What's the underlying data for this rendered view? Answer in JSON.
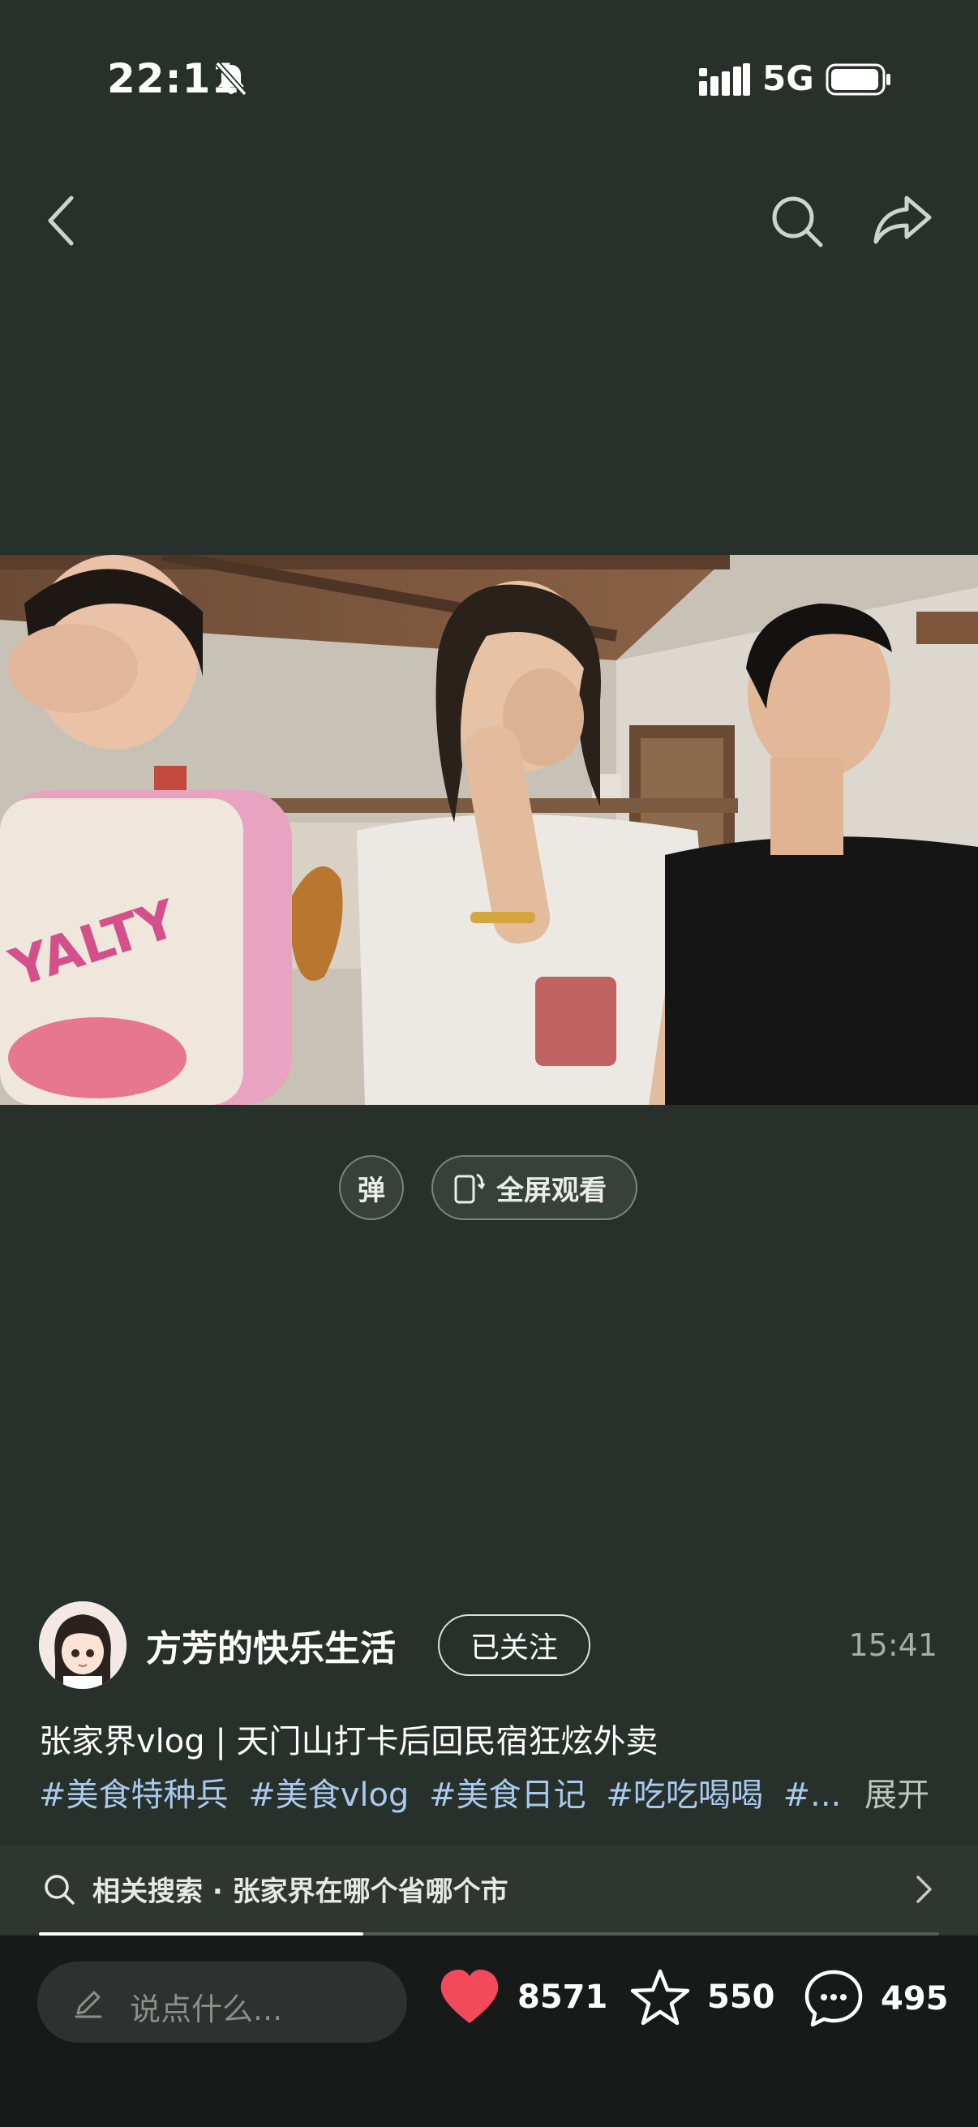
{
  "status_bar": {
    "time": "22:11",
    "network": "5G",
    "icons": [
      "bell-off-icon",
      "signal-icon",
      "battery-icon"
    ]
  },
  "nav": {
    "icons": [
      "back-icon",
      "search-icon",
      "share-icon"
    ]
  },
  "video_controls": {
    "danmaku_label": "弹",
    "fullscreen_label": "全屏观看"
  },
  "author": {
    "name": "方芳的快乐生活",
    "follow_label": "已关注",
    "duration": "15:41"
  },
  "post": {
    "title": "张家界vlog | 天门山打卡后回民宿狂炫外卖",
    "tags": [
      "#美食特种兵",
      "#美食vlog",
      "#美食日记",
      "#吃吃喝喝",
      "#..."
    ],
    "expand_label": "展开"
  },
  "related": {
    "text": "相关搜索 · 张家界在哪个省哪个市",
    "progress": 0.36
  },
  "bottom_bar": {
    "comment_placeholder": "说点什么...",
    "likes": "8571",
    "favorites": "550",
    "comments": "495"
  },
  "colors": {
    "background": "#27302a",
    "like_red": "#f24a5a",
    "tag_blue": "#a9c9ee"
  }
}
